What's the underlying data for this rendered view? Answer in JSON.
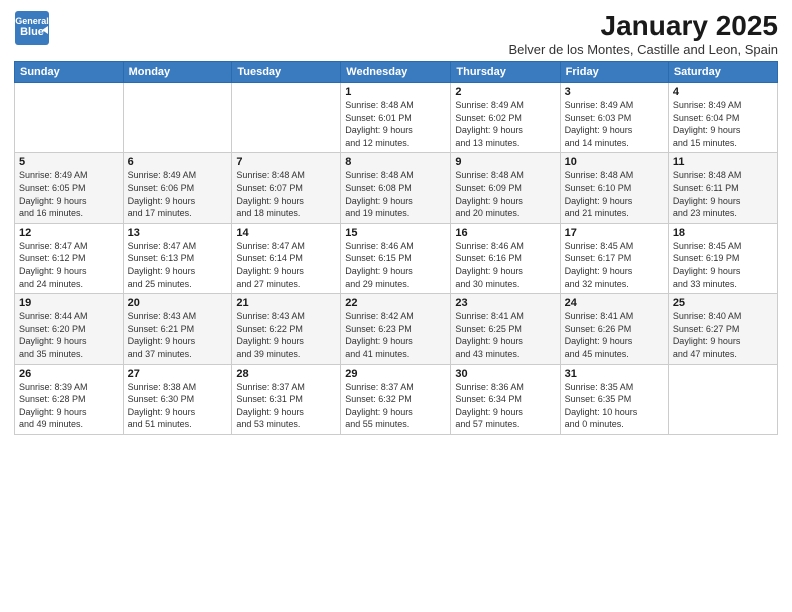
{
  "logo": {
    "line1": "General",
    "line2": "Blue"
  },
  "header": {
    "title": "January 2025",
    "subtitle": "Belver de los Montes, Castille and Leon, Spain"
  },
  "weekdays": [
    "Sunday",
    "Monday",
    "Tuesday",
    "Wednesday",
    "Thursday",
    "Friday",
    "Saturday"
  ],
  "weeks": [
    [
      {
        "day": "",
        "info": ""
      },
      {
        "day": "",
        "info": ""
      },
      {
        "day": "",
        "info": ""
      },
      {
        "day": "1",
        "info": "Sunrise: 8:48 AM\nSunset: 6:01 PM\nDaylight: 9 hours\nand 12 minutes."
      },
      {
        "day": "2",
        "info": "Sunrise: 8:49 AM\nSunset: 6:02 PM\nDaylight: 9 hours\nand 13 minutes."
      },
      {
        "day": "3",
        "info": "Sunrise: 8:49 AM\nSunset: 6:03 PM\nDaylight: 9 hours\nand 14 minutes."
      },
      {
        "day": "4",
        "info": "Sunrise: 8:49 AM\nSunset: 6:04 PM\nDaylight: 9 hours\nand 15 minutes."
      }
    ],
    [
      {
        "day": "5",
        "info": "Sunrise: 8:49 AM\nSunset: 6:05 PM\nDaylight: 9 hours\nand 16 minutes."
      },
      {
        "day": "6",
        "info": "Sunrise: 8:49 AM\nSunset: 6:06 PM\nDaylight: 9 hours\nand 17 minutes."
      },
      {
        "day": "7",
        "info": "Sunrise: 8:48 AM\nSunset: 6:07 PM\nDaylight: 9 hours\nand 18 minutes."
      },
      {
        "day": "8",
        "info": "Sunrise: 8:48 AM\nSunset: 6:08 PM\nDaylight: 9 hours\nand 19 minutes."
      },
      {
        "day": "9",
        "info": "Sunrise: 8:48 AM\nSunset: 6:09 PM\nDaylight: 9 hours\nand 20 minutes."
      },
      {
        "day": "10",
        "info": "Sunrise: 8:48 AM\nSunset: 6:10 PM\nDaylight: 9 hours\nand 21 minutes."
      },
      {
        "day": "11",
        "info": "Sunrise: 8:48 AM\nSunset: 6:11 PM\nDaylight: 9 hours\nand 23 minutes."
      }
    ],
    [
      {
        "day": "12",
        "info": "Sunrise: 8:47 AM\nSunset: 6:12 PM\nDaylight: 9 hours\nand 24 minutes."
      },
      {
        "day": "13",
        "info": "Sunrise: 8:47 AM\nSunset: 6:13 PM\nDaylight: 9 hours\nand 25 minutes."
      },
      {
        "day": "14",
        "info": "Sunrise: 8:47 AM\nSunset: 6:14 PM\nDaylight: 9 hours\nand 27 minutes."
      },
      {
        "day": "15",
        "info": "Sunrise: 8:46 AM\nSunset: 6:15 PM\nDaylight: 9 hours\nand 29 minutes."
      },
      {
        "day": "16",
        "info": "Sunrise: 8:46 AM\nSunset: 6:16 PM\nDaylight: 9 hours\nand 30 minutes."
      },
      {
        "day": "17",
        "info": "Sunrise: 8:45 AM\nSunset: 6:17 PM\nDaylight: 9 hours\nand 32 minutes."
      },
      {
        "day": "18",
        "info": "Sunrise: 8:45 AM\nSunset: 6:19 PM\nDaylight: 9 hours\nand 33 minutes."
      }
    ],
    [
      {
        "day": "19",
        "info": "Sunrise: 8:44 AM\nSunset: 6:20 PM\nDaylight: 9 hours\nand 35 minutes."
      },
      {
        "day": "20",
        "info": "Sunrise: 8:43 AM\nSunset: 6:21 PM\nDaylight: 9 hours\nand 37 minutes."
      },
      {
        "day": "21",
        "info": "Sunrise: 8:43 AM\nSunset: 6:22 PM\nDaylight: 9 hours\nand 39 minutes."
      },
      {
        "day": "22",
        "info": "Sunrise: 8:42 AM\nSunset: 6:23 PM\nDaylight: 9 hours\nand 41 minutes."
      },
      {
        "day": "23",
        "info": "Sunrise: 8:41 AM\nSunset: 6:25 PM\nDaylight: 9 hours\nand 43 minutes."
      },
      {
        "day": "24",
        "info": "Sunrise: 8:41 AM\nSunset: 6:26 PM\nDaylight: 9 hours\nand 45 minutes."
      },
      {
        "day": "25",
        "info": "Sunrise: 8:40 AM\nSunset: 6:27 PM\nDaylight: 9 hours\nand 47 minutes."
      }
    ],
    [
      {
        "day": "26",
        "info": "Sunrise: 8:39 AM\nSunset: 6:28 PM\nDaylight: 9 hours\nand 49 minutes."
      },
      {
        "day": "27",
        "info": "Sunrise: 8:38 AM\nSunset: 6:30 PM\nDaylight: 9 hours\nand 51 minutes."
      },
      {
        "day": "28",
        "info": "Sunrise: 8:37 AM\nSunset: 6:31 PM\nDaylight: 9 hours\nand 53 minutes."
      },
      {
        "day": "29",
        "info": "Sunrise: 8:37 AM\nSunset: 6:32 PM\nDaylight: 9 hours\nand 55 minutes."
      },
      {
        "day": "30",
        "info": "Sunrise: 8:36 AM\nSunset: 6:34 PM\nDaylight: 9 hours\nand 57 minutes."
      },
      {
        "day": "31",
        "info": "Sunrise: 8:35 AM\nSunset: 6:35 PM\nDaylight: 10 hours\nand 0 minutes."
      },
      {
        "day": "",
        "info": ""
      }
    ]
  ]
}
